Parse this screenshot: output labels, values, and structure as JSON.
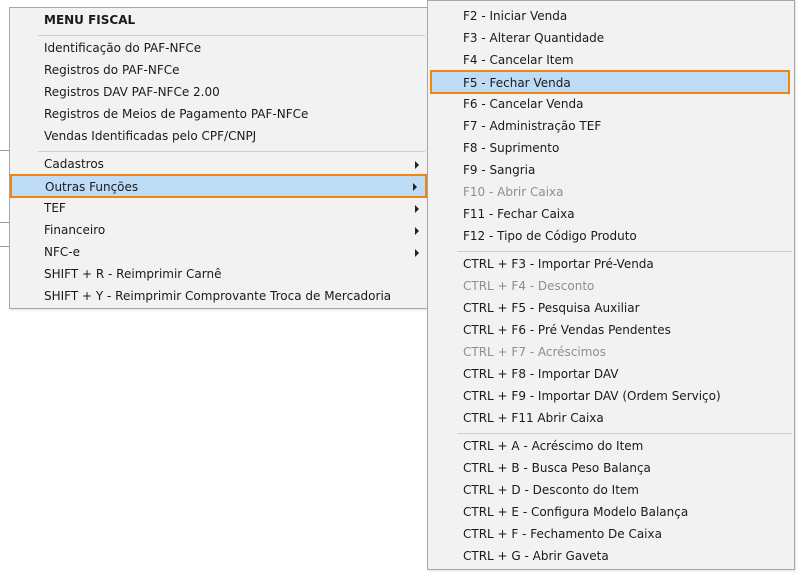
{
  "main_menu": {
    "header": "MENU FISCAL",
    "group1": [
      "Identificação do PAF-NFCe",
      "Registros do PAF-NFCe",
      "Registros DAV PAF-NFCe 2.00",
      "Registros de Meios de Pagamento PAF-NFCe",
      "Vendas Identificadas pelo CPF/CNPJ"
    ],
    "group2": [
      "Cadastros",
      "Outras Funções",
      "TEF",
      "Financeiro",
      "NFC-e",
      "SHIFT + R - Reimprimir Carnê",
      "SHIFT + Y - Reimprimir Comprovante Troca de Mercadoria"
    ]
  },
  "submenu": {
    "group1": [
      "F2 - Iniciar Venda",
      "F3 - Alterar Quantidade",
      "F4 - Cancelar Item",
      "F5 - Fechar Venda",
      "F6 - Cancelar Venda",
      "F7 - Administração TEF",
      "F8 - Suprimento",
      "F9 - Sangria",
      "F10 - Abrir Caixa",
      "F11 - Fechar Caixa",
      "F12 - Tipo de Código Produto"
    ],
    "group2": [
      "CTRL + F3 - Importar Pré-Venda",
      "CTRL + F4 - Desconto",
      "CTRL + F5 - Pesquisa Auxiliar",
      "CTRL + F6 - Pré Vendas Pendentes",
      "CTRL + F7 - Acréscimos",
      "CTRL + F8 - Importar DAV",
      "CTRL + F9 - Importar DAV (Ordem Serviço)",
      "CTRL + F11 Abrir Caixa"
    ],
    "group3": [
      "CTRL + A - Acréscimo do Item",
      "CTRL + B - Busca Peso Balança",
      "CTRL + D - Desconto do Item",
      "CTRL + E - Configura Modelo Balança",
      "CTRL + F - Fechamento De Caixa",
      "CTRL + G - Abrir Gaveta"
    ]
  },
  "colors": {
    "highlight": "#bfdcf6",
    "focus_outline": "#f0860e",
    "menu_bg": "#f2f2f2",
    "disabled_text": "#8e8e8e"
  }
}
